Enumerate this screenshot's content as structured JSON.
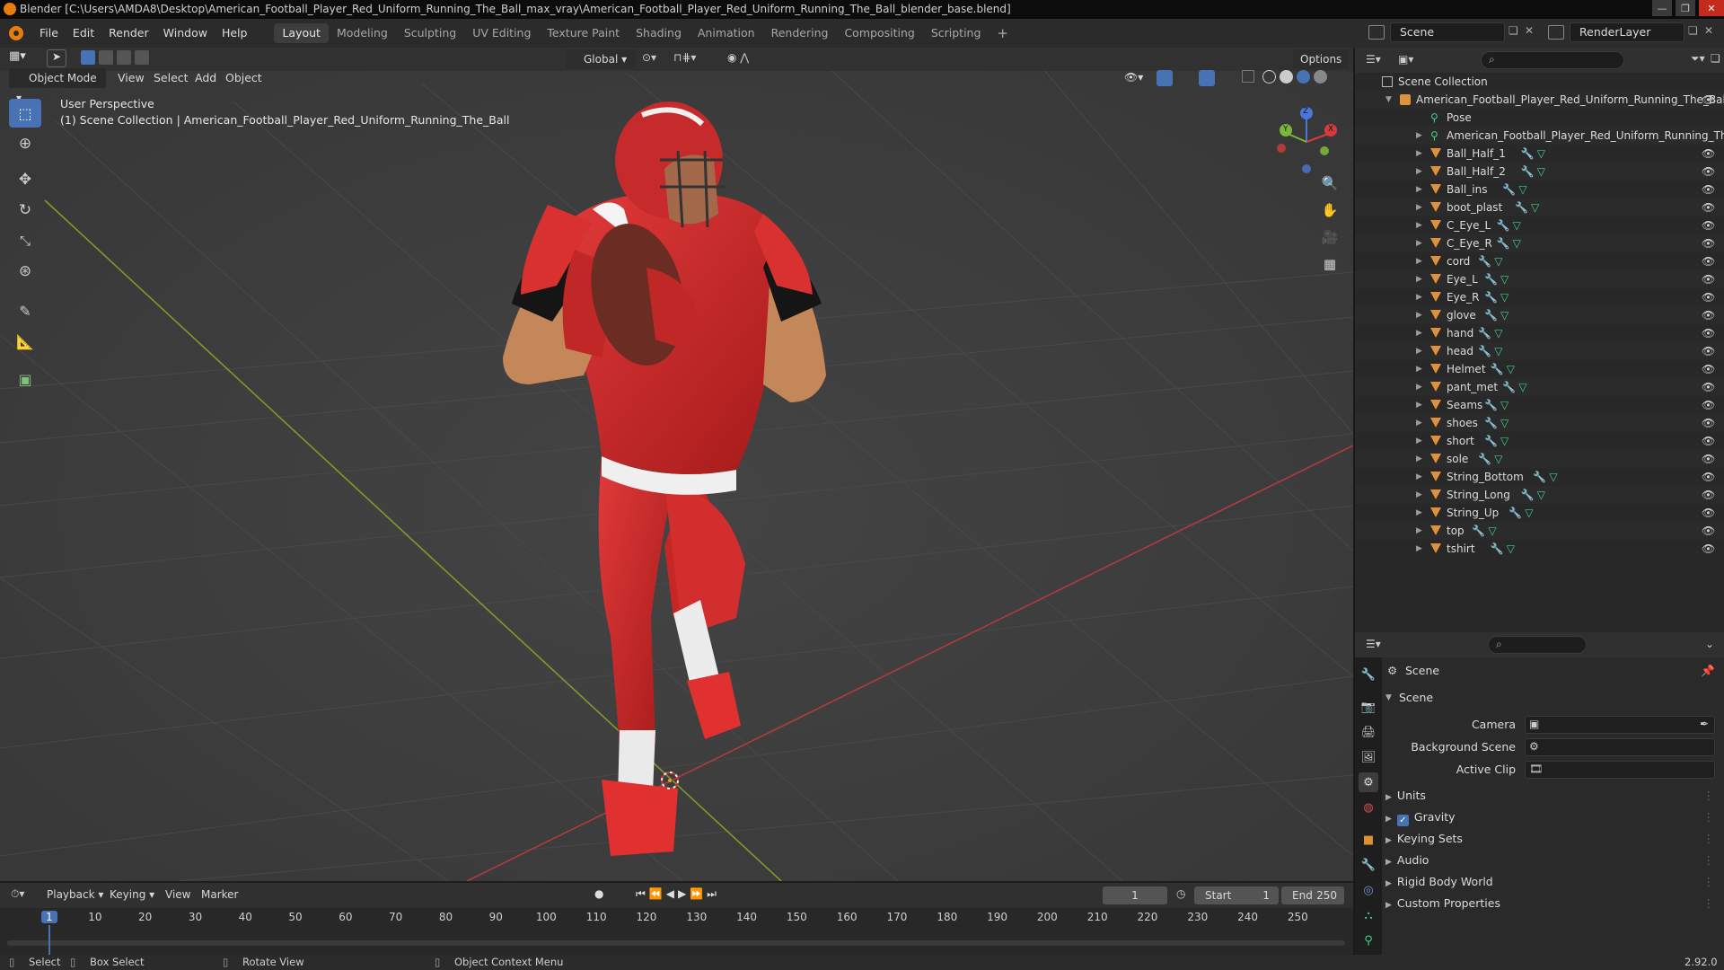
{
  "window": {
    "title": "Blender [C:\\Users\\AMDA8\\Desktop\\American_Football_Player_Red_Uniform_Running_The_Ball_max_vray\\American_Football_Player_Red_Uniform_Running_The_Ball_blender_base.blend]",
    "minimize": "—",
    "maximize": "❐",
    "close": "✕"
  },
  "menus": [
    "File",
    "Edit",
    "Render",
    "Window",
    "Help"
  ],
  "workspaces": [
    "Layout",
    "Modeling",
    "Sculpting",
    "UV Editing",
    "Texture Paint",
    "Shading",
    "Animation",
    "Rendering",
    "Compositing",
    "Scripting"
  ],
  "add_workspace": "+",
  "scene_field": "Scene",
  "layer_field": "RenderLayer",
  "viewport": {
    "mode": "Object Mode",
    "menus": [
      "View",
      "Select",
      "Add",
      "Object"
    ],
    "transform_orientation": "Global",
    "options": "Options",
    "info_line1": "User Perspective",
    "info_line2": "(1) Scene Collection | American_Football_Player_Red_Uniform_Running_The_Ball",
    "gizmo_axes": [
      "X",
      "Y",
      "Z"
    ]
  },
  "outliner": {
    "root": "Scene Collection",
    "collection": "American_Football_Player_Red_Uniform_Running_The_Ball",
    "pose": "Pose",
    "armature": "American_Football_Player_Red_Uniform_Running_The_B",
    "objects": [
      "Ball_Half_1",
      "Ball_Half_2",
      "Ball_ins",
      "boot_plast",
      "C_Eye_L",
      "C_Eye_R",
      "cord",
      "Eye_L",
      "Eye_R",
      "glove",
      "hand",
      "head",
      "Helmet",
      "pant_met",
      "Seams",
      "shoes",
      "short",
      "sole",
      "String_Bottom",
      "String_Long",
      "String_Up",
      "top",
      "tshirt"
    ]
  },
  "properties": {
    "context": "Scene",
    "panel": "Scene",
    "camera_label": "Camera",
    "background_scene_label": "Background Scene",
    "active_clip_label": "Active Clip",
    "sections": [
      "Units",
      "Gravity",
      "Keying Sets",
      "Audio",
      "Rigid Body World",
      "Custom Properties"
    ],
    "gravity_checked": true
  },
  "timeline": {
    "menus": [
      "Playback",
      "Keying",
      "View",
      "Marker"
    ],
    "current_frame": "1",
    "start_label": "Start",
    "start": "1",
    "end_label": "End",
    "end": "250",
    "ticks": [
      "1",
      "10",
      "20",
      "30",
      "40",
      "50",
      "60",
      "70",
      "80",
      "90",
      "100",
      "110",
      "120",
      "130",
      "140",
      "150",
      "160",
      "170",
      "180",
      "190",
      "200",
      "210",
      "220",
      "230",
      "240",
      "250"
    ]
  },
  "statusbar": {
    "select": "Select",
    "box_select": "Box Select",
    "rotate_view": "Rotate View",
    "context_menu": "Object Context Menu",
    "version": "2.92.0"
  }
}
